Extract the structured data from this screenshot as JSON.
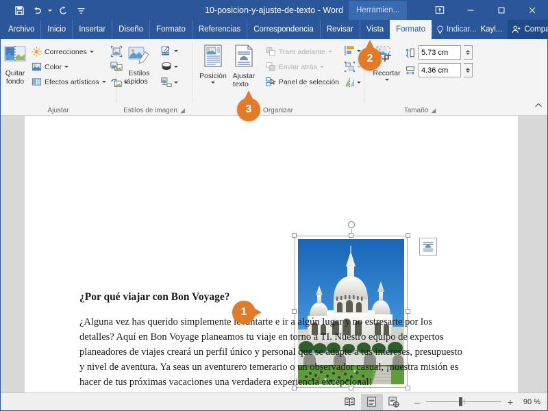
{
  "window": {
    "title": "10-posicion-y-ajuste-de-texto  -  Word",
    "contextual_tab_label": "Herramien...",
    "quick_access": [
      {
        "name": "save",
        "icon": "save-icon"
      },
      {
        "name": "undo",
        "icon": "undo-icon"
      },
      {
        "name": "redo",
        "icon": "redo-icon"
      },
      {
        "name": "customize",
        "icon": "customize-qat-icon"
      }
    ],
    "controls": [
      {
        "name": "ribbon-display-options",
        "icon": "ribbon-display-icon"
      },
      {
        "name": "minimize",
        "icon": "minimize-icon"
      },
      {
        "name": "maximize",
        "icon": "maximize-icon"
      },
      {
        "name": "close",
        "icon": "close-icon"
      }
    ]
  },
  "tabs": [
    {
      "label": "Archivo",
      "active": false
    },
    {
      "label": "Inicio",
      "active": false
    },
    {
      "label": "Insertar",
      "active": false
    },
    {
      "label": "Diseño",
      "active": false
    },
    {
      "label": "Formato",
      "active": false
    },
    {
      "label": "Referencias",
      "active": false
    },
    {
      "label": "Correspondencia",
      "active": false
    },
    {
      "label": "Revisar",
      "active": false
    },
    {
      "label": "Vista",
      "active": false
    },
    {
      "label": "Formato",
      "active": true
    }
  ],
  "tabbar_right": {
    "tell_me": "Indicar...",
    "user": "Kayl...",
    "share": "Compartir"
  },
  "ribbon": {
    "groups": [
      {
        "name": "ajustar",
        "label": "Ajustar",
        "big_buttons": [
          {
            "label_line1": "Quitar",
            "label_line2": "fondo",
            "icon": "remove-background-icon"
          }
        ],
        "small_items": [
          {
            "label": "Correcciones",
            "icon": "corrections-icon",
            "has_menu": true
          },
          {
            "label": "Color",
            "icon": "color-icon",
            "has_menu": true
          },
          {
            "label": "Efectos artísticos",
            "icon": "artistic-effects-icon",
            "has_menu": true
          }
        ],
        "icon_only": [
          {
            "name": "compress-pictures-icon"
          },
          {
            "name": "change-picture-icon"
          },
          {
            "name": "reset-picture-icon"
          }
        ]
      },
      {
        "name": "estilos-de-imagen",
        "label": "Estilos de imagen",
        "big_buttons": [
          {
            "label_line1": "Estilos",
            "label_line2": "rápidos",
            "icon": "quick-styles-icon",
            "has_menu": true
          }
        ],
        "icon_only": [
          {
            "name": "picture-border-icon"
          },
          {
            "name": "picture-effects-icon"
          },
          {
            "name": "picture-layout-icon"
          }
        ],
        "has_dialog_launcher": true
      },
      {
        "name": "organizar",
        "label": "Organizar",
        "big_buttons": [
          {
            "label_line1": "Posición",
            "label_line2": "",
            "icon": "position-icon",
            "has_menu": true
          },
          {
            "label_line1": "Ajustar",
            "label_line2": "texto",
            "icon": "wrap-text-icon",
            "has_menu": true
          }
        ],
        "small_items": [
          {
            "label": "Traer adelante",
            "icon": "bring-forward-icon",
            "disabled": true,
            "has_menu": true
          },
          {
            "label": "Enviar atrás",
            "icon": "send-backward-icon",
            "disabled": true,
            "has_menu": true
          },
          {
            "label": "Panel de selección",
            "icon": "selection-pane-icon",
            "disabled": false
          }
        ],
        "icon_only": [
          {
            "name": "align-objects-icon"
          },
          {
            "name": "group-objects-icon"
          },
          {
            "name": "rotate-objects-icon"
          }
        ]
      },
      {
        "name": "tamano",
        "label": "Tamaño",
        "big_buttons": [
          {
            "label_line1": "Recortar",
            "label_line2": "",
            "icon": "crop-icon",
            "has_menu": true
          }
        ],
        "fields": [
          {
            "name": "shape-height",
            "icon": "height-icon",
            "value": "5.73 cm"
          },
          {
            "name": "shape-width",
            "icon": "width-icon",
            "value": "4.36 cm"
          }
        ],
        "has_dialog_launcher": true
      }
    ],
    "collapse_ribbon_icon": "chevron-up-icon"
  },
  "document": {
    "heading": "¿Por qué viajar con Bon Voyage?",
    "paragraph": "¿Alguna vez has querido simplemente  levantarte e ir a algún lugar y no estresarte por los detalles?  Aquí en Bon Voyage planeamos tu viaje en torno a TI. Nuestro equipo de expertos planeadores de viajes creará un perfil único y personal que se adapte a tus intereses, presupuesto y nivel de aventura. Ya seas un aventurero temerario o un observador casual, ¡nuestra misión es hacer de tus próximas vacaciones una verdadera experiencia excepcional!",
    "picture": {
      "name": "sacre-coeur-basilica-photo",
      "alt": "Basílica del Sagrado Corazón",
      "selected": true,
      "layout_options_icon": "layout-options-tight-wrap-icon",
      "rotate_handle_icon": "rotate-handle-icon"
    }
  },
  "callouts": [
    {
      "number": "1",
      "direction": "right"
    },
    {
      "number": "2",
      "direction": "up"
    },
    {
      "number": "3",
      "direction": "up"
    }
  ],
  "statusbar": {
    "views": [
      {
        "name": "read-mode",
        "icon": "read-mode-icon",
        "active": false
      },
      {
        "name": "print-layout",
        "icon": "print-layout-icon",
        "active": true
      },
      {
        "name": "web-layout",
        "icon": "web-layout-icon",
        "active": false
      }
    ],
    "zoom_out": "–",
    "zoom_in": "+",
    "zoom_percent": "90 %"
  },
  "colors": {
    "word_blue": "#2b579a",
    "accent_orange": "#e07b2a",
    "ribbon_bg": "#f4f4f4",
    "doc_gray": "#d8d8d8"
  }
}
